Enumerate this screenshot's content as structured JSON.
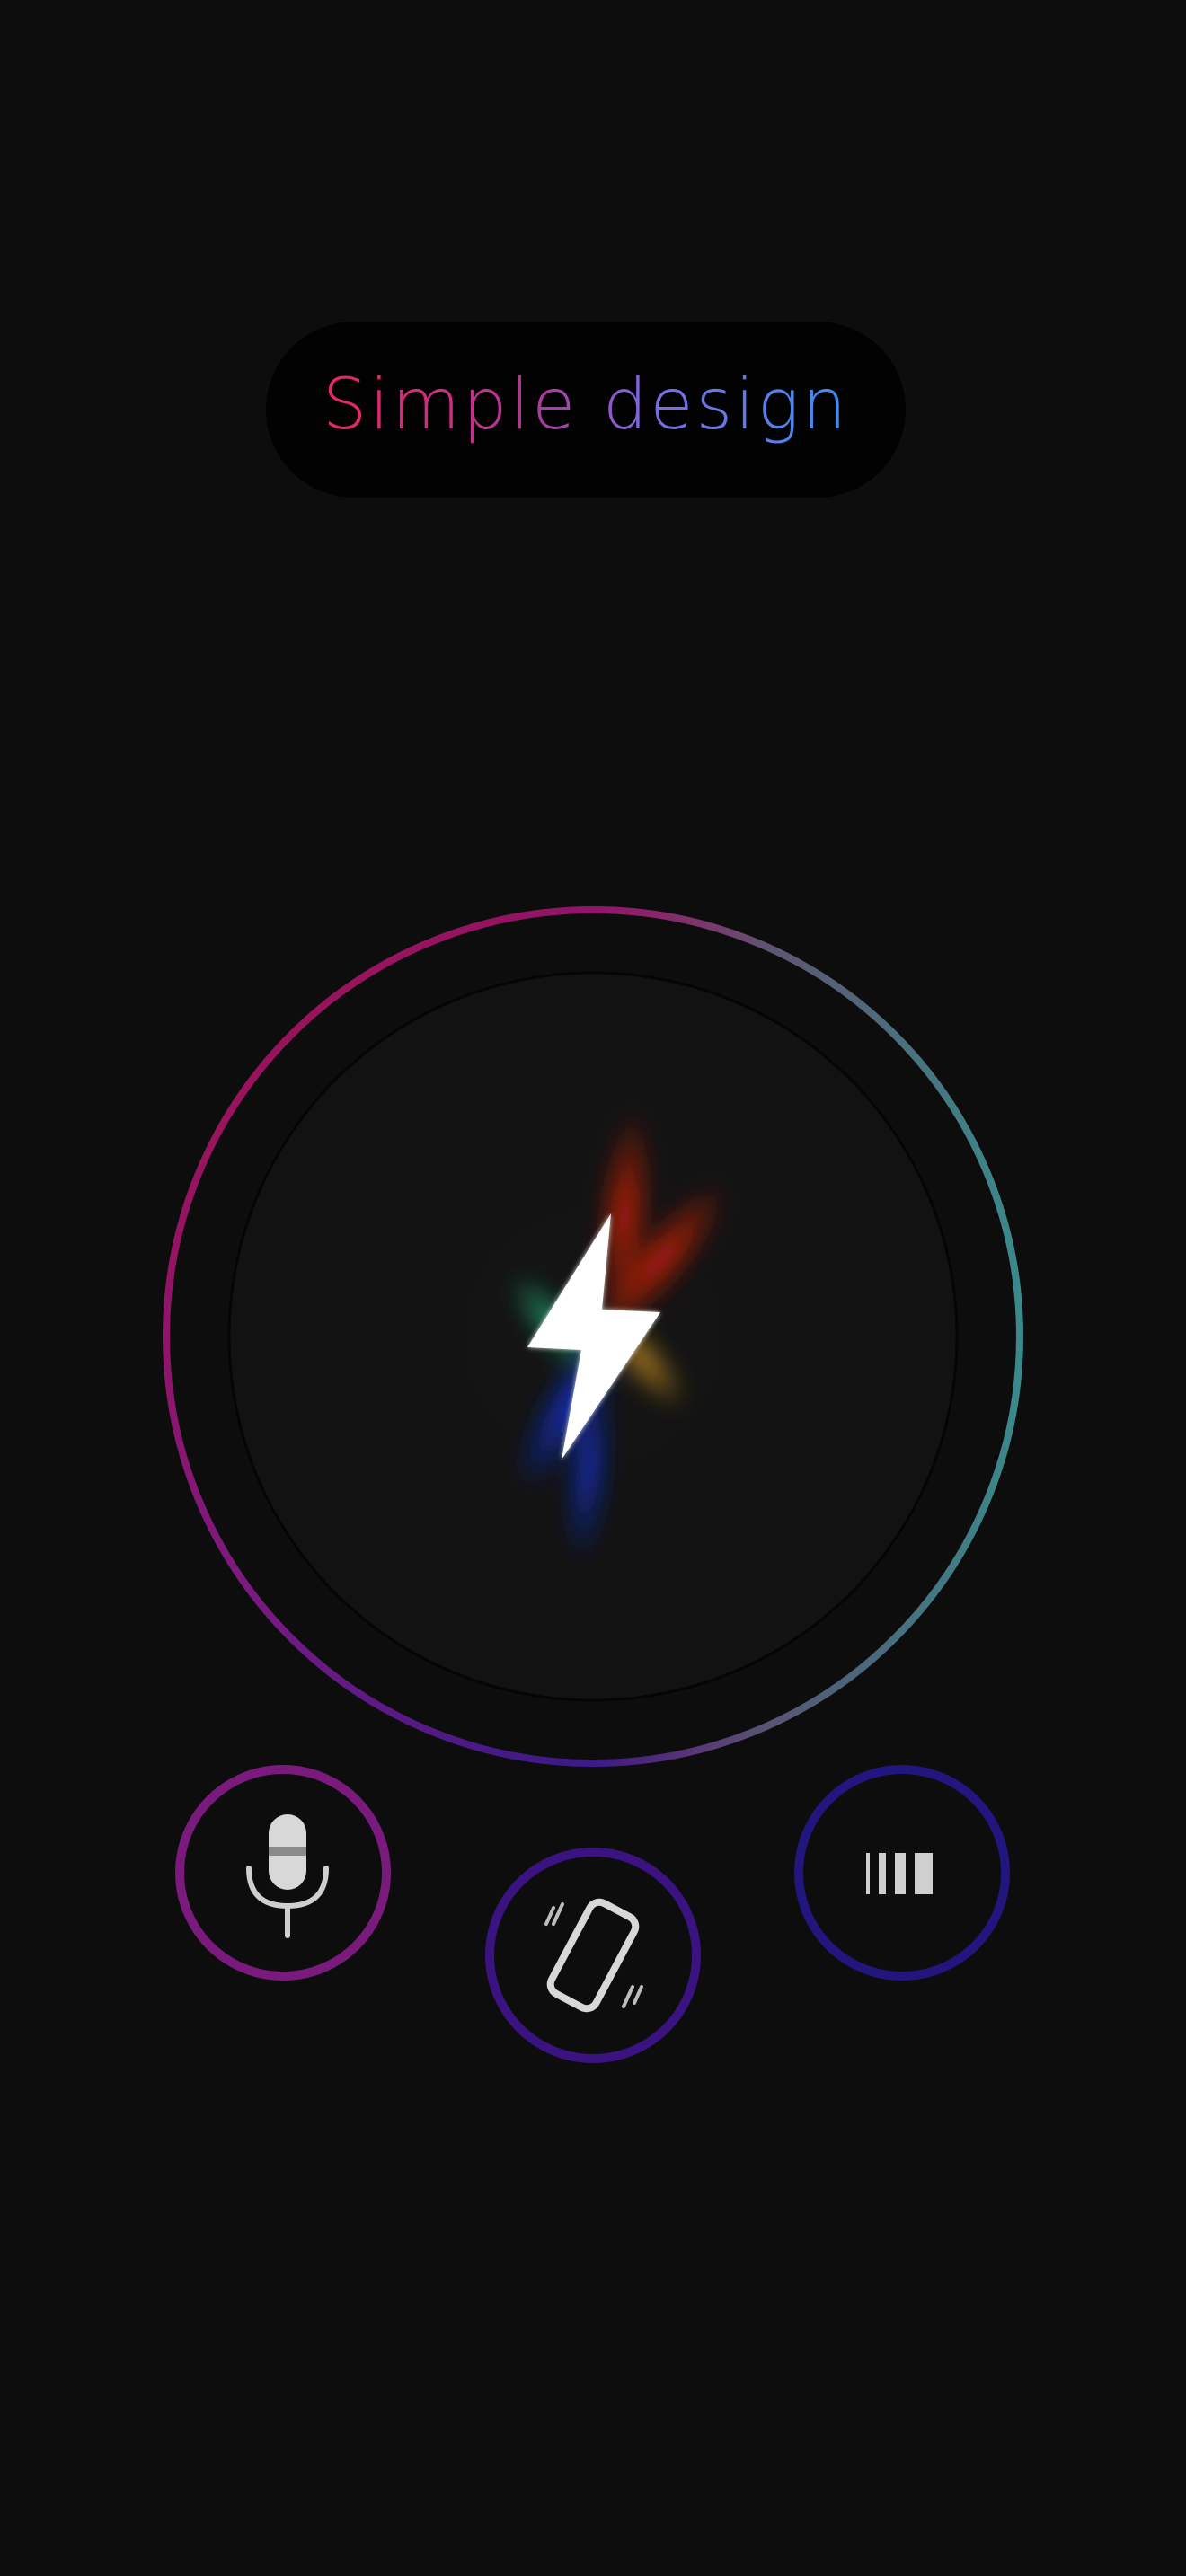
{
  "header": {
    "title_part1": "Simple",
    "title_part2": "design",
    "gradient_colors": [
      "#e8265f",
      "#7b6be0",
      "#3f8ff0"
    ]
  },
  "main_button": {
    "icon": "lightning-bolt-icon",
    "ring_gradient_colors": [
      "#b3134f",
      "#8a1d84",
      "#3a1a8a",
      "#2a4a8e",
      "#3f8a8a"
    ]
  },
  "controls": [
    {
      "id": "microphone",
      "icon": "microphone-icon",
      "ring_color": "#7a1a7d"
    },
    {
      "id": "vibrate",
      "icon": "vibrate-phone-icon",
      "ring_color": "#3a1380"
    },
    {
      "id": "strobe",
      "icon": "strobe-bars-icon",
      "ring_color": "#22157d"
    }
  ]
}
